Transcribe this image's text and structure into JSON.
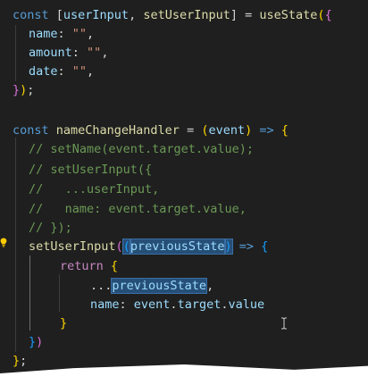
{
  "editor": {
    "colors": {
      "background": "#1f1f1f",
      "keyword": "#569cd6",
      "control": "#c586c0",
      "function": "#dcdcaa",
      "variable": "#9cdcfe",
      "string": "#ce9178",
      "comment": "#6a9955",
      "selection": "#264f78"
    },
    "icons": [
      "lightbulb-icon",
      "text-cursor-icon"
    ],
    "code": {
      "l1": {
        "const": "const",
        "open_bracket": " [",
        "user_input": "userInput",
        "comma": ", ",
        "set_user_input": "setUserInput",
        "close_bracket": "] = ",
        "use_state": "useState",
        "paren_open": "(",
        "brace_open": "{"
      },
      "l2": {
        "key": "name",
        "colon": ": ",
        "value": "\"\"",
        "comma": ","
      },
      "l3": {
        "key": "amount",
        "colon": ": ",
        "value": "\"\"",
        "comma": ","
      },
      "l4": {
        "key": "date",
        "colon": ": ",
        "value": "\"\"",
        "comma": ","
      },
      "l5": {
        "brace_close": "}",
        "paren_close": ")",
        "semi": ";"
      },
      "l7": {
        "const": "const",
        "name_handler": " nameChangeHandler",
        "eq": " = ",
        "paren_open": "(",
        "param": "event",
        "paren_close": ")",
        "arrow": " => ",
        "brace_open": "{"
      },
      "l8": {
        "comment": "// setName(event.target.value);"
      },
      "l9": {
        "comment": "// setUserInput({"
      },
      "l10": {
        "comment": "//   ...userInput,"
      },
      "l11": {
        "comment": "//   name: event.target.value,"
      },
      "l12": {
        "comment": "// });"
      },
      "l13": {
        "call": "setUserInput",
        "paren_open": "(",
        "param_paren_open": "(",
        "param": "previousState",
        "param_paren_close": ")",
        "arrow": " => ",
        "brace_open": "{"
      },
      "l14": {
        "return": "return",
        "space": " ",
        "brace_open": "{"
      },
      "l15": {
        "spread": "...",
        "ref": "previousState",
        "comma": ","
      },
      "l16": {
        "key": "name",
        "colon": ": ",
        "object": "event",
        "dot1": ".",
        "target": "target",
        "dot2": ".",
        "value": "value"
      },
      "l17": {
        "brace_close": "}"
      },
      "l18": {
        "brace_close": "}",
        "paren_close": ")"
      },
      "l19": {
        "brace_close": "}",
        "semi": ";"
      }
    }
  }
}
